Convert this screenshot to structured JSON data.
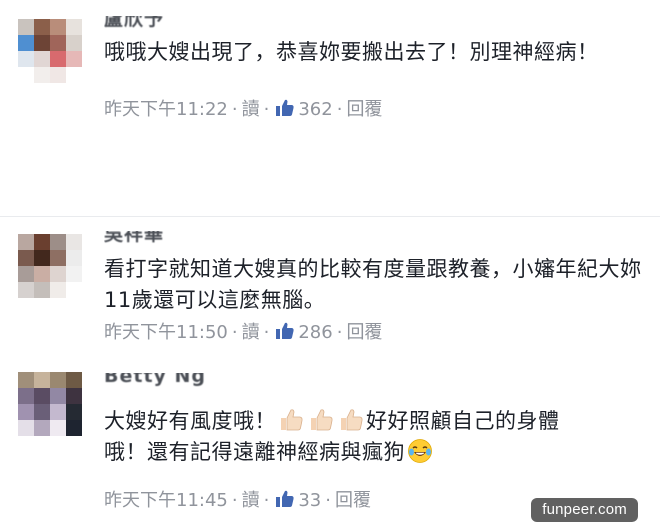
{
  "comments": [
    {
      "name": "盧欣予",
      "text": "哦哦大嫂出現了，恭喜妳要搬出去了！別理神經病！",
      "time": "昨天下午11:22",
      "read": "讀",
      "likes": "362",
      "reply": "回覆"
    },
    {
      "name": "吳祥華",
      "text": "看打字就知道大嫂真的比較有度量跟教養，小嬸年紀大妳11歲還可以這麼無腦。",
      "time": "昨天下午11:50",
      "read": "讀",
      "likes": "286",
      "reply": "回覆"
    },
    {
      "name": "Betty Ng",
      "text_part1": "大嫂好有風度哦！",
      "text_part2": "好好照顧自己的身體",
      "text_part3": "哦！還有記得遠離神經病與瘋狗",
      "time": "昨天下午11:45",
      "read": "讀",
      "likes": "33",
      "reply": "回覆"
    }
  ],
  "separator": "·",
  "icons": {
    "like": "thumbs-up-icon",
    "thumb_emoji": "thumbs-up-emoji",
    "laugh_emoji": "tears-of-joy-emoji"
  },
  "colors": {
    "meta": "#90949c",
    "text": "#1d2129",
    "like_blue": "#4267b2"
  },
  "watermark": "funpeer.com"
}
